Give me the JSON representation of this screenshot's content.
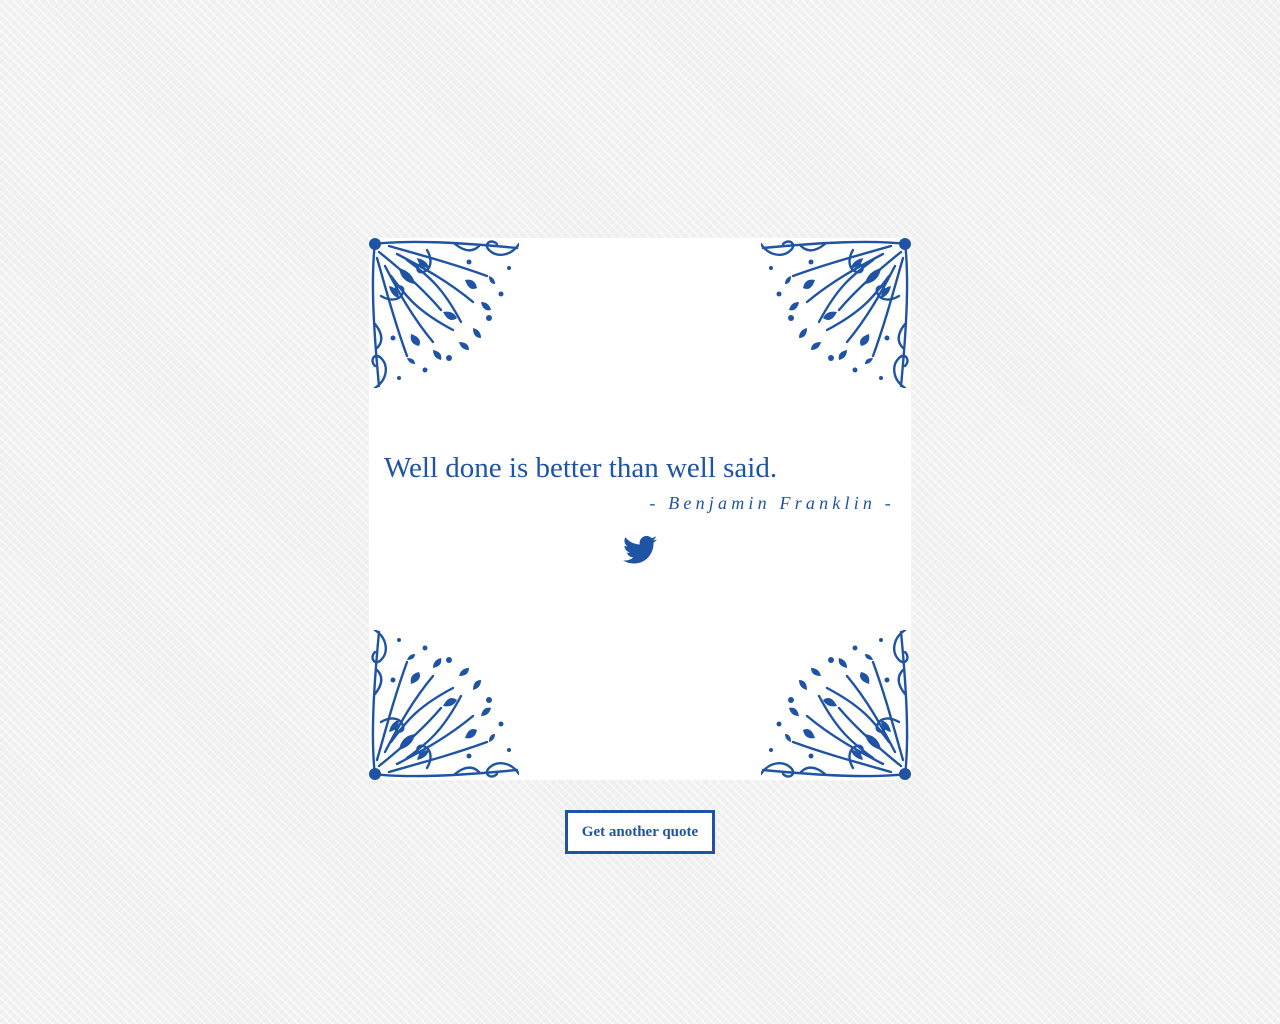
{
  "quote": {
    "text": "Well done is better than well said.",
    "author": "- Benjamin Franklin -"
  },
  "actions": {
    "tweet_icon": "twitter-bird-icon",
    "new_quote_label": "Get another quote"
  },
  "decorations": {
    "corner_icon": "floral-ornament-icon"
  },
  "colors": {
    "accent": "#1f54a4",
    "card_background": "#ffffff",
    "page_background": "#f1f1f1"
  }
}
